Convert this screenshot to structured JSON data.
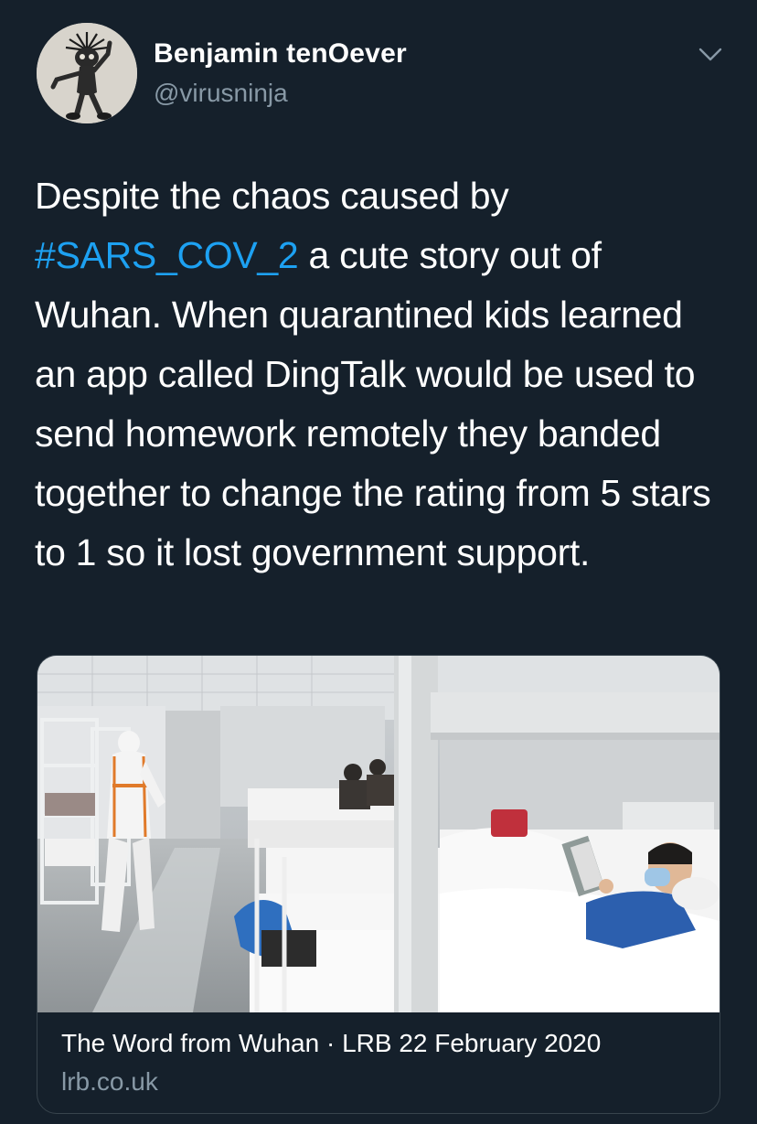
{
  "tweet": {
    "author": {
      "name": "Benjamin tenOever",
      "handle": "@virusninja"
    },
    "text": {
      "before": "Despite the chaos caused by ",
      "hashtag": "#SARS_COV_2",
      "after": " a cute story out of Wuhan. When quarantined kids learned an app called DingTalk would be used to send homework remotely they banded together to change the rating from 5 stars to 1 so it lost government support."
    },
    "card": {
      "title": "The Word from Wuhan · LRB 22 February 2020",
      "domain": "lrb.co.uk"
    },
    "icons": {
      "menu": "chevron-down-icon"
    }
  },
  "colors": {
    "background": "#15202b",
    "link": "#1da1f2",
    "secondary_text": "#8899a6",
    "border": "#38444d"
  }
}
